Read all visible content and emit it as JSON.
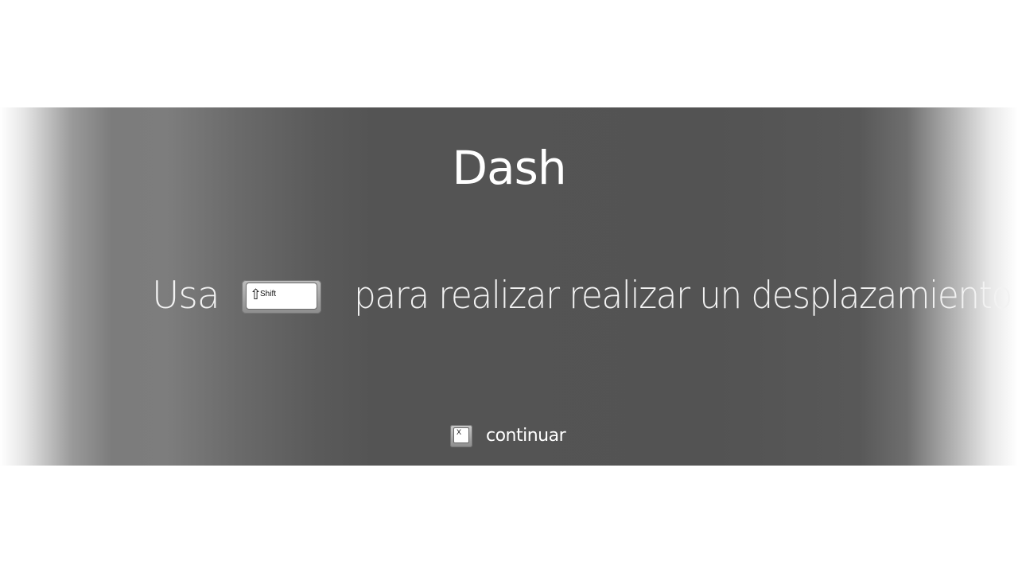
{
  "screen": {
    "title": "Dash",
    "instruction": {
      "prefix": "Usa",
      "key_label": "Shift",
      "key_symbol": "⇧",
      "suffix": "para realizar realizar un desplazamiento"
    },
    "continue": {
      "key_label": "X",
      "label": "continuar"
    }
  },
  "colors": {
    "banner_dark": "#535353",
    "banner_light": "#7c7c7c",
    "text": "#ffffff",
    "page_background": "#ffffff"
  },
  "icons": {
    "shift_key": "shift-key-icon",
    "x_button": "x-button-icon"
  }
}
